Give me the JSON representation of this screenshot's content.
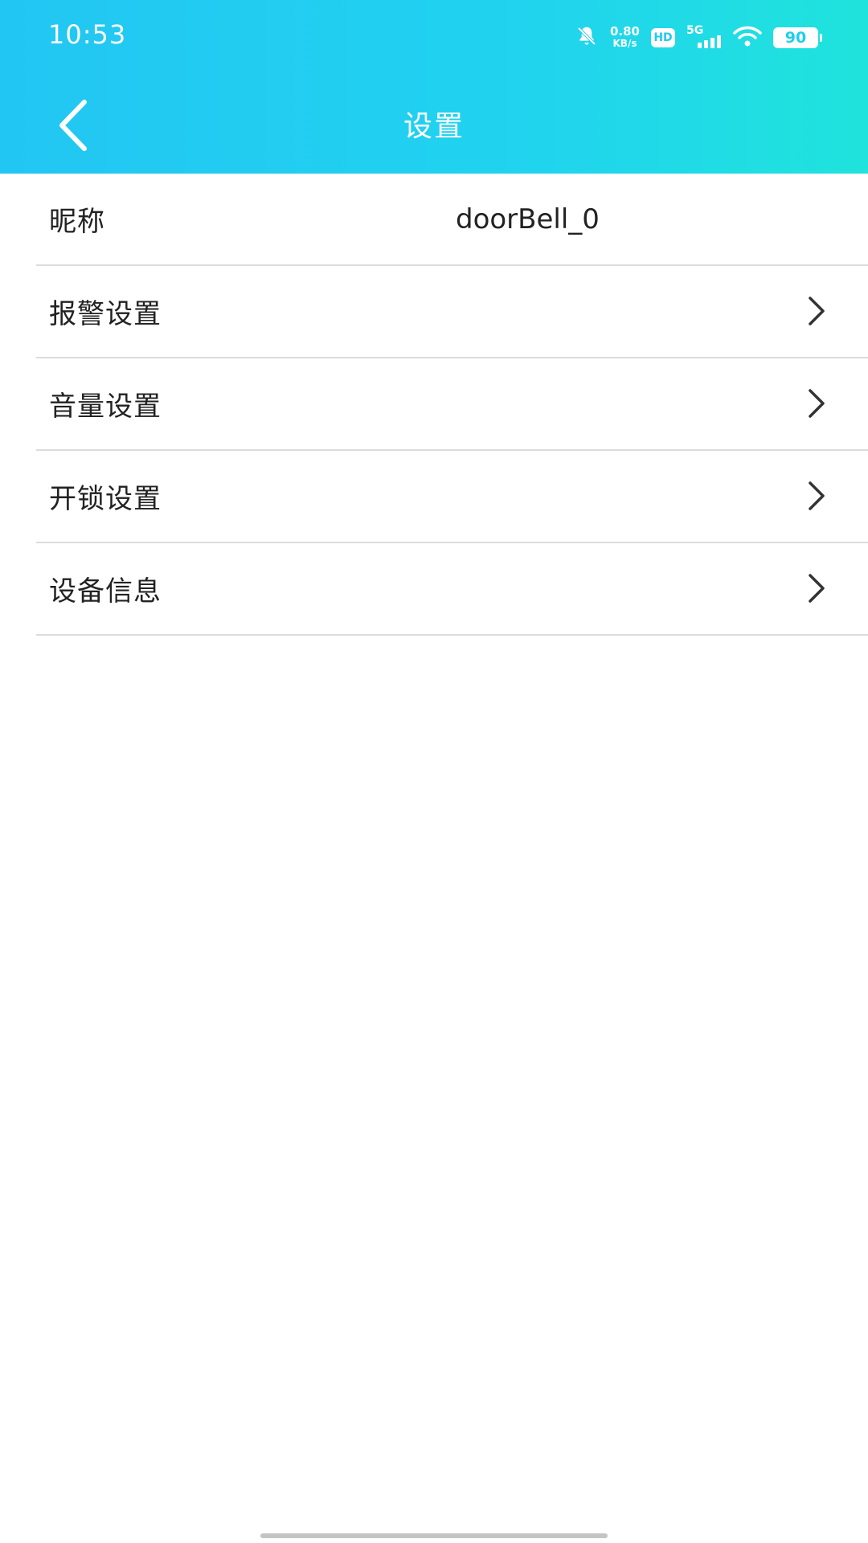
{
  "status_bar": {
    "time": "10:53",
    "net_speed_value": "0.80",
    "net_speed_unit": "KB/s",
    "hd_label": "HD",
    "network_label": "5G",
    "battery_level": "90"
  },
  "navbar": {
    "title": "设置"
  },
  "settings": {
    "items": [
      {
        "label": "昵称",
        "value": "doorBell_0"
      },
      {
        "label": "报警设置"
      },
      {
        "label": "音量设置"
      },
      {
        "label": "开锁设置"
      },
      {
        "label": "设备信息"
      }
    ]
  },
  "colors": {
    "header_gradient_start": "#22c6f3",
    "header_gradient_end": "#1fe3dc",
    "divider": "#dcdcdc",
    "text": "#222222"
  },
  "icons": [
    "bell-muted-icon",
    "hd-icon",
    "signal-5g-icon",
    "wifi-icon",
    "battery-icon",
    "back-arrow-icon",
    "chevron-right-icon"
  ]
}
